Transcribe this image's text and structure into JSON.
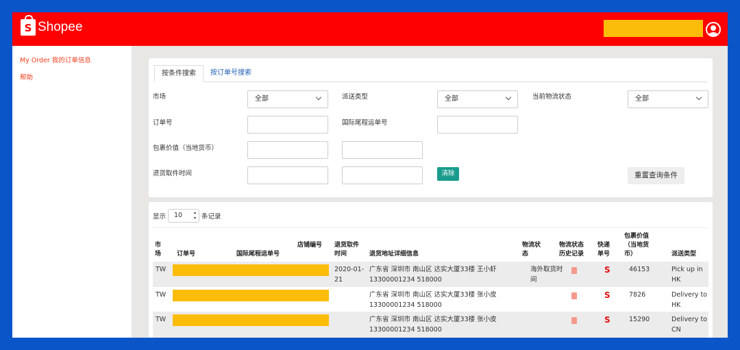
{
  "header": {
    "logo_text": "Shopee",
    "logo_letter": "S"
  },
  "sidebar": {
    "items": [
      {
        "label": "My Order 我的订单信息"
      },
      {
        "label": "帮助"
      }
    ]
  },
  "tabs": [
    {
      "label": "按条件搜索"
    },
    {
      "label": "按订单号搜索"
    }
  ],
  "form": {
    "market_label": "市场",
    "market_value": "全部",
    "delivery_type_label": "派送类型",
    "delivery_type_value": "全部",
    "logistics_status_label": "当前物流状态",
    "logistics_status_value": "全部",
    "order_no_label": "订单号",
    "intl_tracking_label": "国际尾程运单号",
    "package_value_label": "包裹价值（当地货币）",
    "pickup_time_label": "退货取件时间",
    "clear_label": "清除",
    "reset_label": "重置查询条件"
  },
  "table": {
    "show_label": "显示",
    "page_size": "10",
    "records_label": "条记录",
    "headers": [
      "市场",
      "订单号",
      "国际尾程运单号",
      "店铺编号",
      "退货取件时间",
      "退货地址详细信息",
      "物流状态",
      "物流状态历史记录",
      "快递单号",
      "包裹价值（当地货币）",
      "派送类型"
    ],
    "rows": [
      {
        "market": "TW",
        "pickup_time": "2020-01-21",
        "address": "广东省 深圳市 南山区 达实大厦33楼 王小虾 13300001234 518000",
        "status": "海外取货时间",
        "value": "46153",
        "delivery": "Pick up in HK"
      },
      {
        "market": "TW",
        "pickup_time": "",
        "address": "广东省 深圳市 南山区 达实大厦33楼 张小皮 13300001234 518000",
        "status": "",
        "value": "7826",
        "delivery": "Delivery to HK"
      },
      {
        "market": "TW",
        "pickup_time": "",
        "address": "广东省 深圳市 南山区 达实大厦33楼 张小皮 13300001234 518000",
        "status": "",
        "value": "15290",
        "delivery": "Delivery to CN"
      }
    ]
  }
}
